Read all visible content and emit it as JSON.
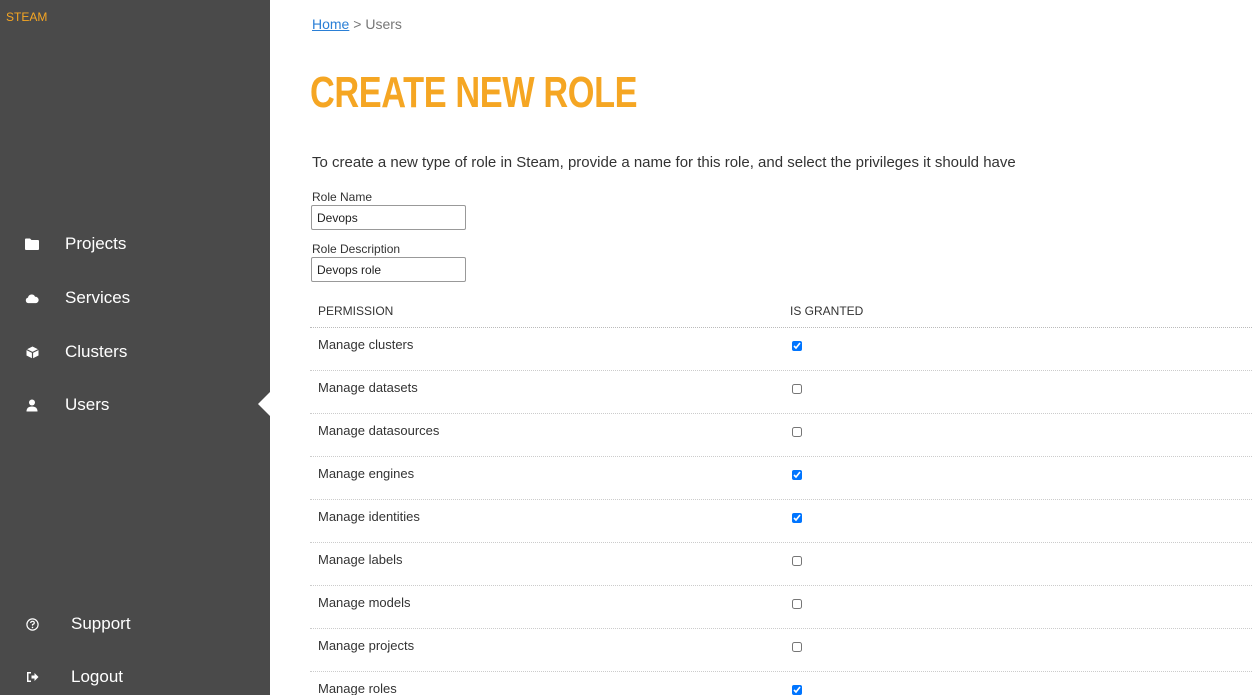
{
  "sidebar": {
    "brand": "STEAM",
    "items": [
      {
        "label": "Projects",
        "icon": "folder-icon"
      },
      {
        "label": "Services",
        "icon": "cloud-icon"
      },
      {
        "label": "Clusters",
        "icon": "cube-icon"
      },
      {
        "label": "Users",
        "icon": "user-icon",
        "active": true
      }
    ],
    "bottom": [
      {
        "label": "Support",
        "icon": "question-circle-icon"
      },
      {
        "label": "Logout",
        "icon": "sign-out-icon"
      }
    ]
  },
  "breadcrumb": {
    "home": "Home",
    "separator": ">",
    "current": "Users"
  },
  "page": {
    "title": "CREATE NEW ROLE",
    "intro": "To create a new type of role in Steam, provide a name for this role, and select the privileges it should have"
  },
  "form": {
    "role_name": {
      "label": "Role Name",
      "value": "Devops"
    },
    "role_description": {
      "label": "Role Description",
      "value": "Devops role"
    }
  },
  "permissions": {
    "header_permission": "PERMISSION",
    "header_granted": "IS GRANTED",
    "rows": [
      {
        "name": "Manage clusters",
        "granted": true
      },
      {
        "name": "Manage datasets",
        "granted": false
      },
      {
        "name": "Manage datasources",
        "granted": false
      },
      {
        "name": "Manage engines",
        "granted": true
      },
      {
        "name": "Manage identities",
        "granted": true
      },
      {
        "name": "Manage labels",
        "granted": false
      },
      {
        "name": "Manage models",
        "granted": false
      },
      {
        "name": "Manage projects",
        "granted": false
      },
      {
        "name": "Manage roles",
        "granted": true
      }
    ]
  },
  "colors": {
    "accent": "#f5a623",
    "sidebar": "#4a4a4a",
    "link": "#2a7fd6"
  }
}
